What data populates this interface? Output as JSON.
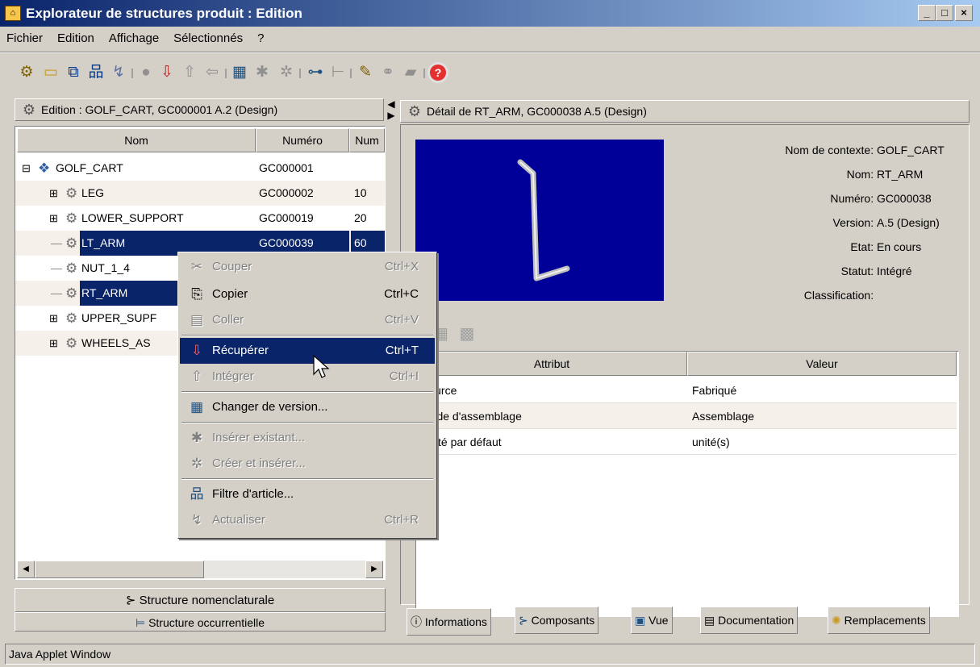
{
  "window": {
    "title": "Explorateur de structures produit : Edition"
  },
  "menu": [
    "Fichier",
    "Edition",
    "Affichage",
    "Sélectionnés",
    "?"
  ],
  "left_panel": {
    "header": "Edition : GOLF_CART, GC000001 A.2 (Design)",
    "columns": [
      "Nom",
      "Numéro",
      "Num"
    ],
    "rows": [
      {
        "name": "GOLF_CART",
        "number": "GC000001",
        "num": ""
      },
      {
        "name": "LEG",
        "number": "GC000002",
        "num": "10"
      },
      {
        "name": "LOWER_SUPPORT",
        "number": "GC000019",
        "num": "20"
      },
      {
        "name": "LT_ARM",
        "number": "GC000039",
        "num": "60"
      },
      {
        "name": "NUT_1_4",
        "number": "",
        "num": ""
      },
      {
        "name": "RT_ARM",
        "number": "",
        "num": ""
      },
      {
        "name": "UPPER_SUPF",
        "number": "",
        "num": ""
      },
      {
        "name": "WHEELS_AS",
        "number": "",
        "num": ""
      }
    ],
    "tabs": [
      "Structure nomenclaturale",
      "Structure occurrentielle"
    ]
  },
  "context_menu": [
    {
      "label": "Couper",
      "shortcut": "Ctrl+X",
      "icon": "scissors-icon",
      "disabled": true
    },
    {
      "label": "Copier",
      "shortcut": "Ctrl+C",
      "icon": "copy-icon",
      "disabled": false
    },
    {
      "label": "Coller",
      "shortcut": "Ctrl+V",
      "icon": "paste-icon",
      "disabled": true
    },
    {
      "label": "Récupérer",
      "shortcut": "Ctrl+T",
      "icon": "checkout-icon",
      "disabled": false,
      "active": true
    },
    {
      "label": "Intégrer",
      "shortcut": "Ctrl+I",
      "icon": "checkin-icon",
      "disabled": true
    },
    {
      "label": "Changer de version...",
      "shortcut": "",
      "icon": "revise-icon",
      "disabled": false
    },
    {
      "label": "Insérer existant...",
      "shortcut": "",
      "icon": "insert-existing-icon",
      "disabled": true
    },
    {
      "label": "Créer et insérer...",
      "shortcut": "",
      "icon": "create-insert-icon",
      "disabled": true
    },
    {
      "label": "Filtre d'article...",
      "shortcut": "",
      "icon": "filter-icon",
      "disabled": false
    },
    {
      "label": "Actualiser",
      "shortcut": "Ctrl+R",
      "icon": "refresh-icon",
      "disabled": true
    }
  ],
  "right_panel": {
    "header": "Détail de RT_ARM, GC000038 A.5 (Design)",
    "details": [
      {
        "label": "Nom de contexte:",
        "value": "GOLF_CART"
      },
      {
        "label": "Nom:",
        "value": "RT_ARM"
      },
      {
        "label": "Numéro:",
        "value": "GC000038"
      },
      {
        "label": "Version:",
        "value": "A.5 (Design)"
      },
      {
        "label": "Etat:",
        "value": "En cours"
      },
      {
        "label": "Statut:",
        "value": "Intégré"
      },
      {
        "label": "Classification:",
        "value": ""
      }
    ],
    "attr_columns": [
      "Attribut",
      "Valeur"
    ],
    "attributes": [
      {
        "attr": "Source",
        "value": "Fabriqué"
      },
      {
        "attr": "Mode d'assemblage",
        "value": "Assemblage"
      },
      {
        "attr": "Unité par défaut",
        "value": "unité(s)"
      }
    ],
    "tabs": [
      "Informations",
      "Composants",
      "Vue",
      "Documentation",
      "Remplacements"
    ]
  },
  "status": "Java Applet Window",
  "colors": {
    "title_start": "#0a246a",
    "title_end": "#a6caf0",
    "selection": "#0a246a",
    "preview_bg": "#000099"
  }
}
